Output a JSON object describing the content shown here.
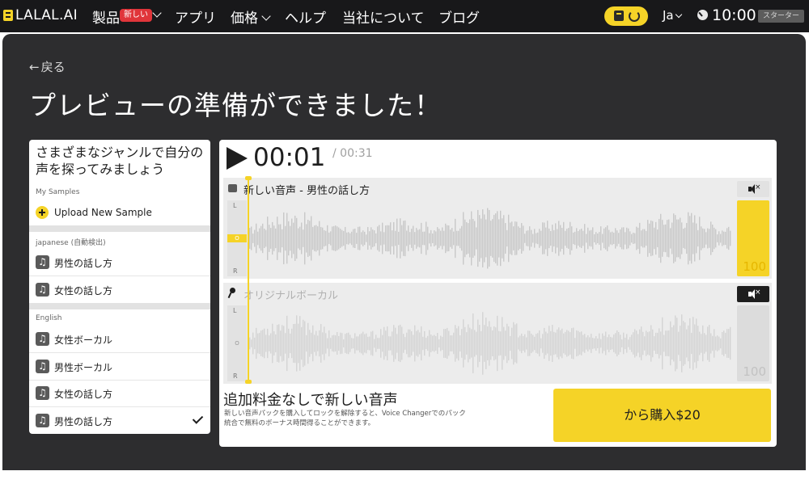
{
  "nav": {
    "logo": "LALAL.AI",
    "products": "製品",
    "new_badge": "新しい",
    "apps": "アプリ",
    "pricing": "価格",
    "help": "ヘルプ",
    "about": "当社について",
    "blog": "ブログ",
    "language": "Ja",
    "time": "10:00",
    "plan": "スターター"
  },
  "main": {
    "back": "戻る",
    "title": "プレビューの準備ができました！"
  },
  "samples": {
    "heading": "さまざまなジャンルで自分の声を探ってみましょう",
    "my_samples_label": "My Samples",
    "upload": "Upload New Sample",
    "groups": [
      {
        "label": "japanese (自動検出)",
        "items": [
          "男性の話し方",
          "女性の話し方"
        ]
      },
      {
        "label": "English",
        "items": [
          "女性ボーカル",
          "男性ボーカル",
          "女性の話し方",
          "男性の話し方"
        ]
      }
    ]
  },
  "player": {
    "current_time": "00:01",
    "total_time": "/ 00:31",
    "tracks": [
      {
        "title": "新しい音声 - 男性の話し方",
        "volume": "100",
        "muted": false,
        "channel_top": "L",
        "channel_mid": "O",
        "channel_bottom": "R"
      },
      {
        "title": "オリジナルボーカル",
        "volume": "100",
        "muted": true,
        "channel_top": "L",
        "channel_mid": "O",
        "channel_bottom": "R"
      }
    ],
    "mute_x": "×"
  },
  "promo": {
    "title": "追加料金なしで新しい音声",
    "description": "新しい音声パックを購入してロックを解除すると、Voice Changerでのパック統合で無料のボーナス時間得ることができます。",
    "buy_button": "から購入$20"
  },
  "colors": {
    "accent": "#f5d327",
    "nav_bg": "#18181a",
    "panel_bg": "#2d2d2f",
    "badge": "#e0353a"
  },
  "icons": [
    "logo-icon",
    "chevron-down-icon",
    "credits-icon",
    "clock-icon",
    "back-arrow-icon",
    "plus-icon",
    "music-note-icon",
    "check-icon",
    "play-icon",
    "speaker-icon",
    "microphone-icon"
  ]
}
